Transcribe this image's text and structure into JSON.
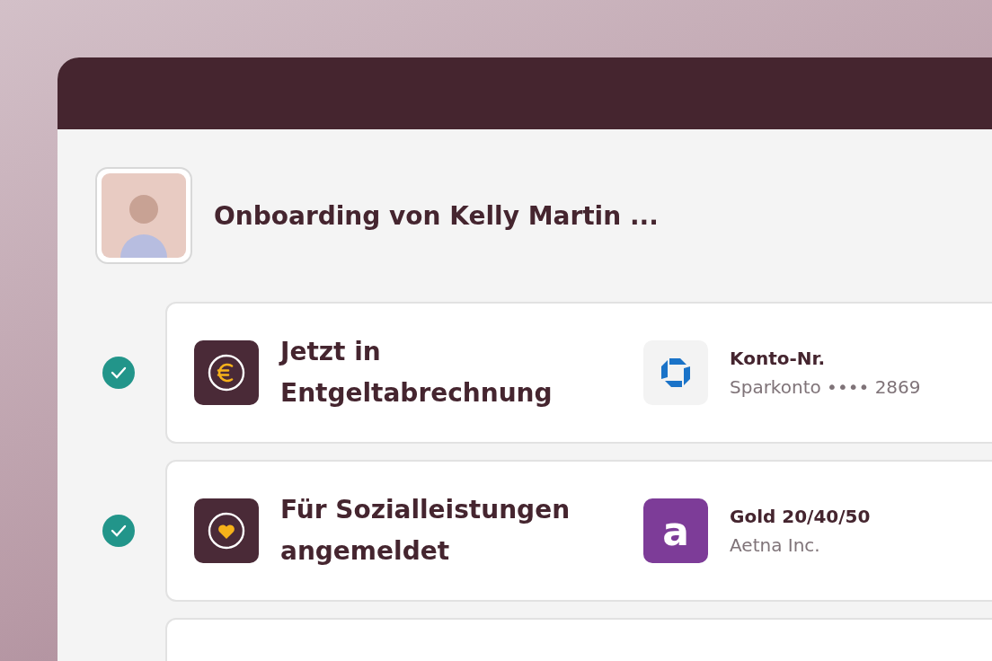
{
  "header": {
    "title": "Onboarding von Kelly Martin ..."
  },
  "steps": [
    {
      "kind": "payroll",
      "completed": true,
      "title": "Jetzt in Entgeltabrechnung",
      "detail": {
        "kind": "bank",
        "label": "Konto-Nr.",
        "value": "Sparkonto •••• 2869"
      }
    },
    {
      "kind": "benefits",
      "completed": true,
      "title": "Für Sozialleistungen angemeldet",
      "detail": {
        "kind": "letter",
        "logo_text": "a",
        "label": "Gold 20/40/50",
        "value": "Aetna Inc."
      }
    },
    {
      "kind": "pending",
      "completed": false
    }
  ]
}
